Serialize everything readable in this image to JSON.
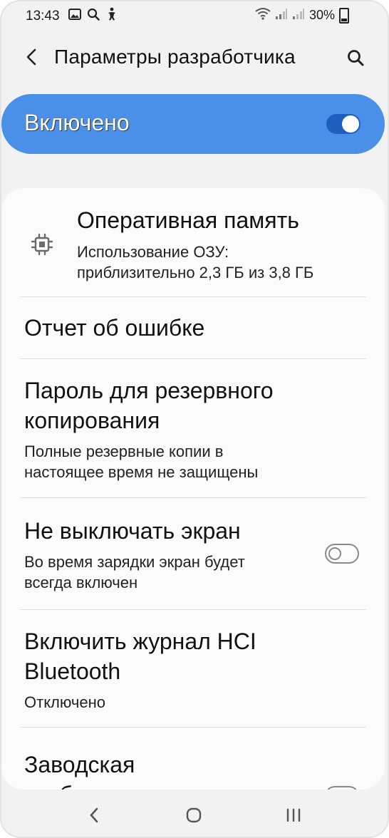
{
  "status_bar": {
    "time": "13:43",
    "battery": "30%",
    "icons_left": [
      "gallery-icon",
      "search-icon",
      "accessibility-icon"
    ],
    "icons_right": [
      "wifi-icon",
      "signal-icon",
      "signal-icon",
      "battery-icon"
    ]
  },
  "app_bar": {
    "title": "Параметры разработчика"
  },
  "master_switch": {
    "label": "Включено",
    "state": true,
    "accent": "#4a90e8"
  },
  "settings": {
    "items": [
      {
        "title": "Оперативная память",
        "subtitle_line1": "Использование ОЗУ:",
        "subtitle_line2": "приблизительно 2,3 ГБ из 3,8 ГБ",
        "icon": "memory-chip-icon"
      },
      {
        "title": "Отчет об ошибке"
      },
      {
        "title_line1": "Пароль для резервного",
        "title_line2": "копирования",
        "subtitle_line1": "Полные резервные копии в",
        "subtitle_line2": "настоящее время не защищены"
      },
      {
        "title": "Не выключать экран",
        "subtitle_line1": "Во время зарядки экран будет",
        "subtitle_line2": "всегда включен",
        "toggle": false
      },
      {
        "title_line1": "Включить журнал HCI",
        "title_line2": "Bluetooth",
        "subtitle": "Отключено"
      },
      {
        "title_line1": "Заводская",
        "title_line2": "разблокировка",
        "toggle": false
      }
    ]
  },
  "nav_bar": {
    "buttons": [
      "back",
      "home",
      "recents"
    ]
  }
}
